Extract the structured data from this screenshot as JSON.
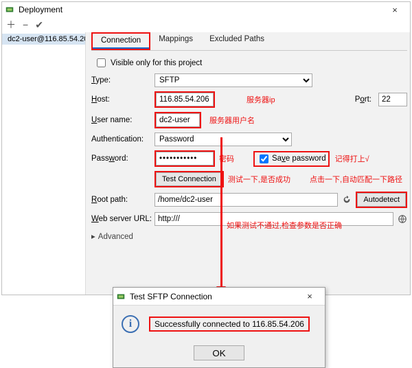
{
  "window": {
    "title": "Deployment",
    "toolbar_hint": "+ − ✓",
    "close": "×"
  },
  "sidebar": {
    "server_label": "dc2-user@116.85.54.20"
  },
  "tabs": {
    "connection": "Connection",
    "mappings": "Mappings",
    "excluded": "Excluded Paths"
  },
  "form": {
    "visible_only": "Visible only for this project",
    "type_label": "Type:",
    "type_value": "SFTP",
    "host_label": "Host:",
    "host_value": "116.85.54.206",
    "port_label": "Port:",
    "port_value": "22",
    "user_label": "User name:",
    "user_value": "dc2-user",
    "auth_label": "Authentication:",
    "auth_value": "Password",
    "password_label": "Password:",
    "password_dots": "●●●●●●●●●●●",
    "save_password": "Save password",
    "test_button": "Test Connection",
    "root_label": "Root path:",
    "root_value": "/home/dc2-user",
    "autodetect": "Autodetect",
    "web_label": "Web server URL:",
    "web_value": "http:///",
    "advanced": "Advanced"
  },
  "annotations": {
    "host": "服务器ip",
    "user": "服务器用户名",
    "password": "密码",
    "save_pw": "记得打上√",
    "test": "测试一下,是否成功",
    "autodetect": "点击一下,自动匹配一下路径",
    "arrow": "如果测试不通过,检查参数是否正确"
  },
  "dialog": {
    "title": "Test SFTP Connection",
    "message": "Successfully connected to 116.85.54.206",
    "ok": "OK",
    "close": "×"
  }
}
